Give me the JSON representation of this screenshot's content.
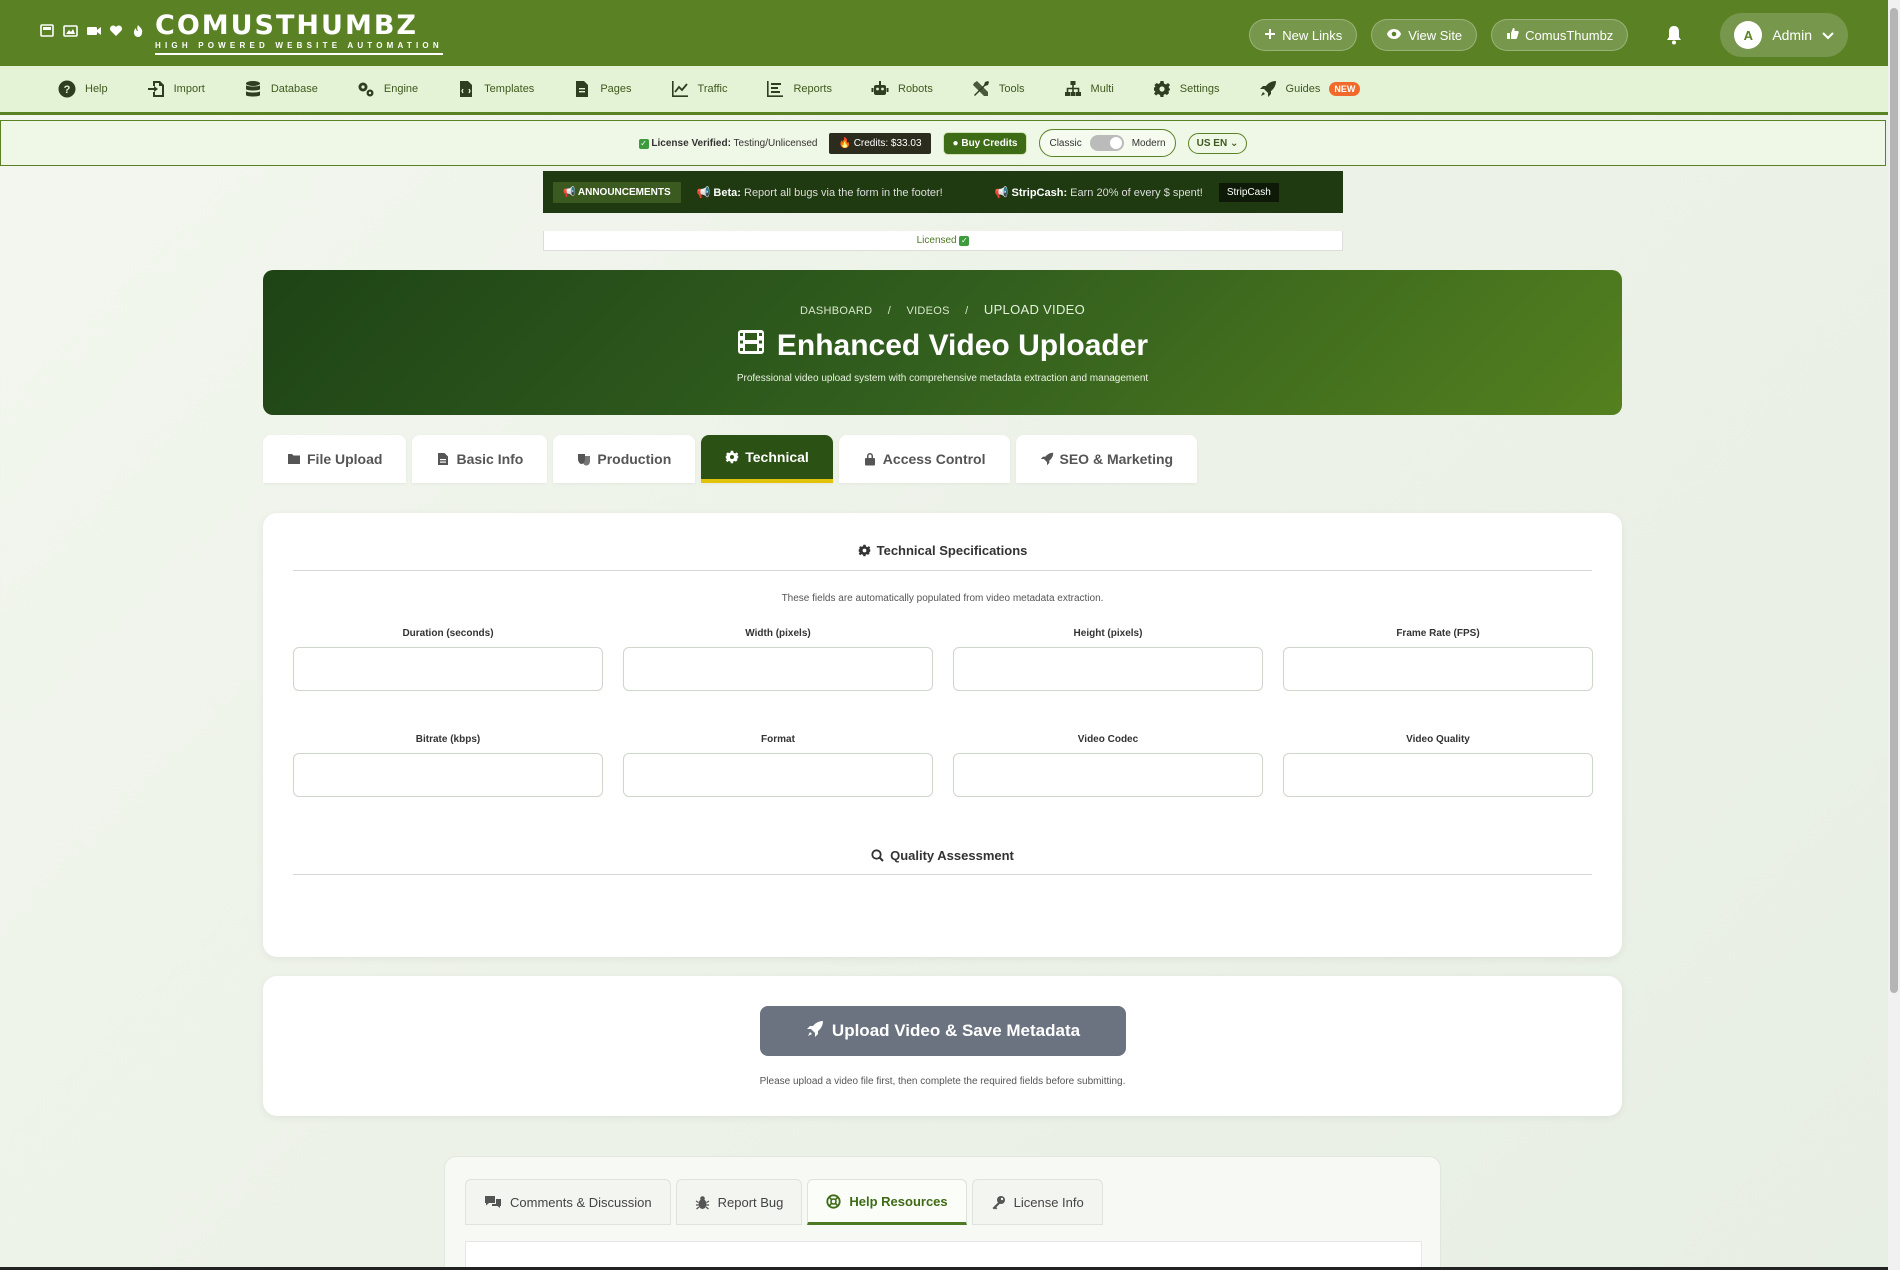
{
  "brand": {
    "name": "COMUSTHUMBZ",
    "tagline": "HIGH POWERED WEBSITE AUTOMATION",
    "color": "#5a8225"
  },
  "topbar": {
    "new_links": "New Links",
    "view_site": "View Site",
    "comusthumbz": "ComusThumbz",
    "admin_initial": "A",
    "admin_label": "Admin"
  },
  "nav": {
    "items": [
      {
        "label": "Help",
        "icon": "help-icon"
      },
      {
        "label": "Import",
        "icon": "import-icon"
      },
      {
        "label": "Database",
        "icon": "database-icon"
      },
      {
        "label": "Engine",
        "icon": "gears-icon"
      },
      {
        "label": "Templates",
        "icon": "template-icon"
      },
      {
        "label": "Pages",
        "icon": "pages-icon"
      },
      {
        "label": "Traffic",
        "icon": "chart-line-icon"
      },
      {
        "label": "Reports",
        "icon": "reports-icon"
      },
      {
        "label": "Robots",
        "icon": "robot-icon"
      },
      {
        "label": "Tools",
        "icon": "tools-icon"
      },
      {
        "label": "Multi",
        "icon": "sitemap-icon"
      },
      {
        "label": "Settings",
        "icon": "gear-icon"
      },
      {
        "label": "Guides",
        "icon": "rocket-icon"
      }
    ],
    "new_badge": "NEW"
  },
  "license_bar": {
    "verified_label": "License Verified:",
    "verified_value": "Testing/Unlicensed",
    "credits": "Credits: $33.03",
    "buy_credits": "Buy Credits",
    "classic": "Classic",
    "modern": "Modern",
    "lang": "US EN"
  },
  "announcements": {
    "label": "ANNOUNCEMENTS",
    "beta_label": "Beta:",
    "beta_text": "Report all bugs via the form in the footer!",
    "strip_label": "StripCash:",
    "strip_text": "Earn 20% of every $ spent!",
    "strip_button": "StripCash",
    "licensed": "Licensed"
  },
  "hero": {
    "breadcrumb": [
      "DASHBOARD",
      "VIDEOS",
      "UPLOAD VIDEO"
    ],
    "separator": "/",
    "title": "Enhanced Video Uploader",
    "subtitle": "Professional video upload system with comprehensive metadata extraction and management"
  },
  "tabs": [
    {
      "label": "File Upload",
      "active": false
    },
    {
      "label": "Basic Info",
      "active": false
    },
    {
      "label": "Production",
      "active": false
    },
    {
      "label": "Technical",
      "active": true
    },
    {
      "label": "Access Control",
      "active": false
    },
    {
      "label": "SEO & Marketing",
      "active": false
    }
  ],
  "technical": {
    "title": "Technical Specifications",
    "note": "These fields are automatically populated from video metadata extraction.",
    "fields": [
      {
        "label": "Duration (seconds)",
        "value": ""
      },
      {
        "label": "Width (pixels)",
        "value": ""
      },
      {
        "label": "Height (pixels)",
        "value": ""
      },
      {
        "label": "Frame Rate (FPS)",
        "value": ""
      },
      {
        "label": "Bitrate (kbps)",
        "value": ""
      },
      {
        "label": "Format",
        "value": ""
      },
      {
        "label": "Video Codec",
        "value": ""
      },
      {
        "label": "Video Quality",
        "value": ""
      }
    ],
    "quality_title": "Quality Assessment"
  },
  "submit": {
    "button": "Upload Video & Save Metadata",
    "note": "Please upload a video file first, then complete the required fields before submitting."
  },
  "footer_tabs": [
    {
      "label": "Comments & Discussion",
      "active": false
    },
    {
      "label": "Report Bug",
      "active": false
    },
    {
      "label": "Help Resources",
      "active": true
    },
    {
      "label": "License Info",
      "active": false
    }
  ]
}
